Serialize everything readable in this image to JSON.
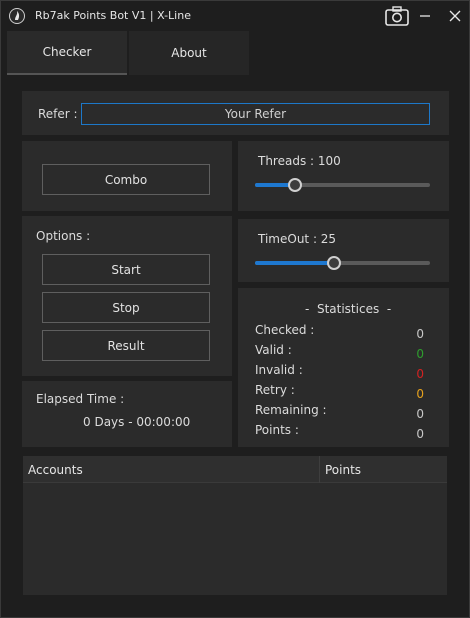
{
  "window": {
    "title": "Rb7ak Points Bot V1 | X-Line",
    "icons": {
      "app": "app-logo-icon",
      "camera": "camera-icon",
      "minimize": "minimize-icon",
      "close": "close-icon"
    }
  },
  "tabs": [
    {
      "label": "Checker",
      "active": true
    },
    {
      "label": "About",
      "active": false
    }
  ],
  "refer": {
    "label": "Refer :",
    "value": "Your Refer"
  },
  "combo": {
    "label": "Combo"
  },
  "threads": {
    "label": "Threads : 100",
    "value": 100,
    "fraction": 0.23
  },
  "timeout": {
    "label": "TimeOut : 25",
    "value": 25,
    "fraction": 0.45
  },
  "options": {
    "title": "Options :",
    "start": "Start",
    "stop": "Stop",
    "result": "Result"
  },
  "elapsed": {
    "label": "Elapsed Time :",
    "value": "0 Days - 00:00:00"
  },
  "statistics": {
    "title": "-  Statistices  -",
    "rows": [
      {
        "label": "Checked :",
        "value": "0",
        "color": "#c8c8c8"
      },
      {
        "label": "Valid :",
        "value": "0",
        "color": "#2e9e2e"
      },
      {
        "label": "Invalid :",
        "value": "0",
        "color": "#d32222"
      },
      {
        "label": "Retry :",
        "value": "0",
        "color": "#e6a21e"
      },
      {
        "label": "Remaining :",
        "value": "0",
        "color": "#c8c8c8"
      },
      {
        "label": "Points :",
        "value": "0",
        "color": "#c8c8c8"
      }
    ]
  },
  "grid": {
    "columns": [
      "Accounts",
      "Points"
    ]
  },
  "colors": {
    "accent": "#1e78d0",
    "background": "#1e1e1e",
    "panel": "#2b2b2b"
  }
}
